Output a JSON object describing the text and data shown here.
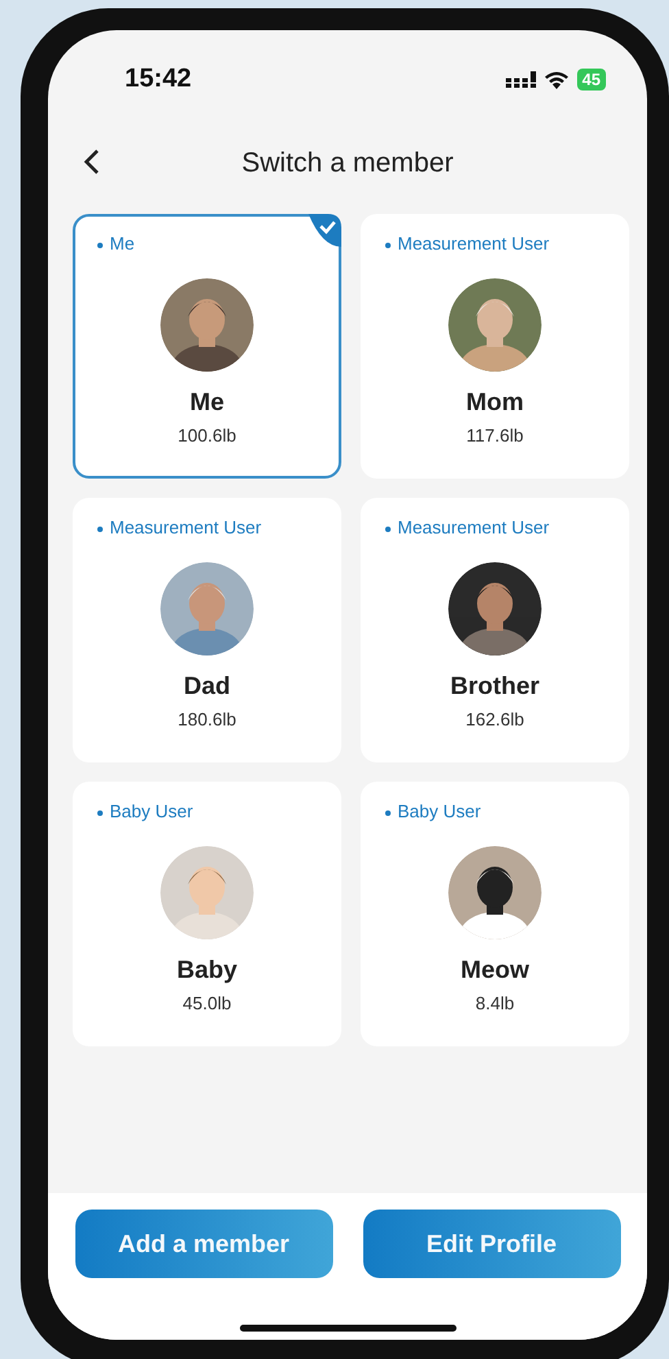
{
  "status_bar": {
    "time": "15:42",
    "battery": "45"
  },
  "header": {
    "title": "Switch a member"
  },
  "members": [
    {
      "tag": "Me",
      "name": "Me",
      "weight": "100.6lb",
      "selected": true,
      "kind": "picture"
    },
    {
      "tag": "Measurement User",
      "name": "Mom",
      "weight": "117.6lb",
      "selected": false,
      "kind": "picture"
    },
    {
      "tag": "Measurement User",
      "name": "Dad",
      "weight": "180.6lb",
      "selected": false,
      "kind": "picture"
    },
    {
      "tag": "Measurement User",
      "name": "Brother",
      "weight": "162.6lb",
      "selected": false,
      "kind": "picture"
    },
    {
      "tag": "Baby User",
      "name": "Baby",
      "weight": "45.0lb",
      "selected": false,
      "kind": "picture"
    },
    {
      "tag": "Baby User",
      "name": "Meow",
      "weight": "8.4lb",
      "selected": false,
      "kind": "picture"
    }
  ],
  "buttons": [
    "Add a member",
    "Edit Profile"
  ]
}
